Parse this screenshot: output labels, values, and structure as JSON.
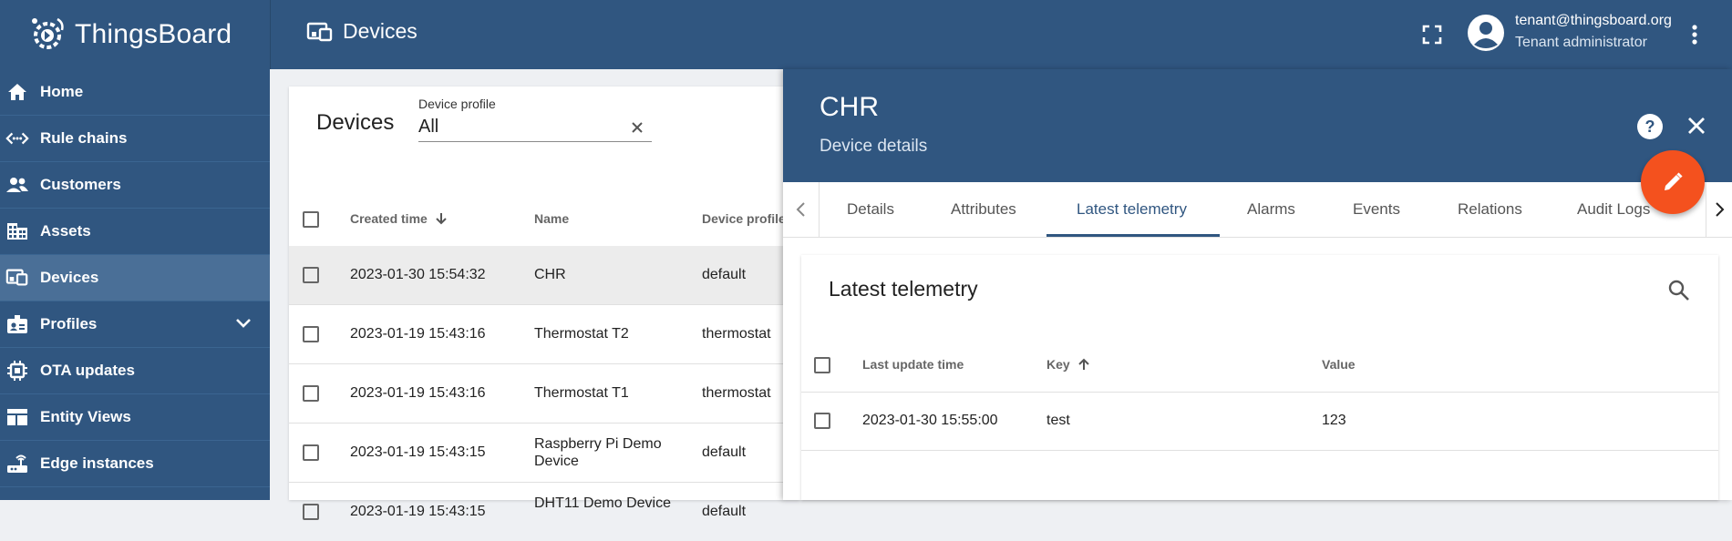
{
  "app": {
    "title": "ThingsBoard"
  },
  "header": {
    "page_title": "Devices",
    "user_email": "tenant@thingsboard.org",
    "user_role": "Tenant administrator"
  },
  "sidebar": {
    "items": [
      {
        "label": "Home",
        "icon": "home-icon"
      },
      {
        "label": "Rule chains",
        "icon": "rule-chains-icon"
      },
      {
        "label": "Customers",
        "icon": "customers-icon"
      },
      {
        "label": "Assets",
        "icon": "assets-icon"
      },
      {
        "label": "Devices",
        "icon": "devices-icon",
        "active": true
      },
      {
        "label": "Profiles",
        "icon": "profiles-icon",
        "expandable": true
      },
      {
        "label": "OTA updates",
        "icon": "ota-icon"
      },
      {
        "label": "Entity Views",
        "icon": "entity-views-icon"
      },
      {
        "label": "Edge instances",
        "icon": "edge-icon"
      }
    ]
  },
  "devices": {
    "title": "Devices",
    "profile_filter": {
      "label": "Device profile",
      "value": "All"
    },
    "columns": [
      "Created time",
      "Name",
      "Device profile"
    ],
    "rows": [
      {
        "created": "2023-01-30 15:54:32",
        "name": "CHR",
        "profile": "default"
      },
      {
        "created": "2023-01-19 15:43:16",
        "name": "Thermostat T2",
        "profile": "thermostat"
      },
      {
        "created": "2023-01-19 15:43:16",
        "name": "Thermostat T1",
        "profile": "thermostat"
      },
      {
        "created": "2023-01-19 15:43:15",
        "name": "Raspberry Pi Demo Device",
        "profile": "default"
      },
      {
        "created": "2023-01-19 15:43:15",
        "name": "DHT11 Demo Device",
        "profile": "default"
      }
    ]
  },
  "details": {
    "title": "CHR",
    "subtitle": "Device details",
    "tabs": [
      "Details",
      "Attributes",
      "Latest telemetry",
      "Alarms",
      "Events",
      "Relations",
      "Audit Logs"
    ],
    "active_tab": "Latest telemetry",
    "telemetry": {
      "title": "Latest telemetry",
      "columns": [
        "Last update time",
        "Key",
        "Value"
      ],
      "rows": [
        {
          "time": "2023-01-30 15:55:00",
          "key": "test",
          "value": "123"
        }
      ]
    }
  },
  "colors": {
    "primary": "#305680",
    "accent": "#f4511e",
    "active_nav": "#4a6f97"
  }
}
